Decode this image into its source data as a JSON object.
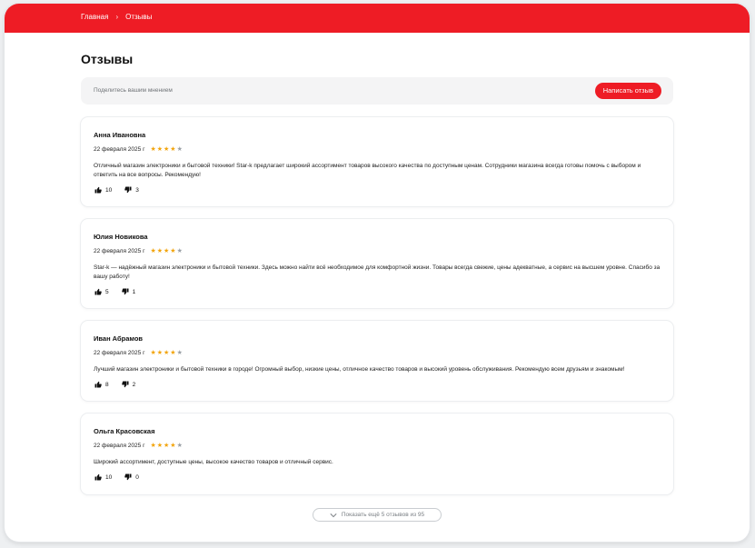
{
  "breadcrumb": {
    "home": "Главная",
    "separator": "›",
    "current": "Отзывы"
  },
  "page": {
    "title": "Отзывы"
  },
  "share": {
    "prompt": "Поделитесь вашим мнением",
    "button_label": "Написать отзыв"
  },
  "reviews": [
    {
      "author": "Анна Ивановна",
      "date": "22 февраля 2025 г",
      "rating": 4,
      "text": "Отличный магазин электроники и бытовой техники! Star-k предлагает широкий ассортимент товаров высокого качества по доступным ценам. Сотрудники магазина всегда готовы помочь с выбором и ответить на все вопросы. Рекомендую!",
      "likes": "10",
      "dislikes": "3"
    },
    {
      "author": "Юлия Новикова",
      "date": "22 февраля 2025 г",
      "rating": 4,
      "text": "Star-k — надёжный магазин электроники и бытовой техники. Здесь можно найти всё необходимое для комфортной жизни. Товары всегда свежие, цены адекватные, а сервис на высшем уровне. Спасибо за вашу работу!",
      "likes": "5",
      "dislikes": "1"
    },
    {
      "author": "Иван Абрамов",
      "date": "22 февраля 2025 г",
      "rating": 4,
      "text": "Лучший магазин электроники и бытовой техники в городе! Огромный выбор, низкие цены, отличное качество товаров и высокий уровень обслуживания. Рекомендую всем друзьям и знакомым!",
      "likes": "8",
      "dislikes": "2"
    },
    {
      "author": "Ольга Красовская",
      "date": "22 февраля 2025 г",
      "rating": 4,
      "text": "Широкий ассортимент, доступные цены, высокое качество товаров и отличный сервис.",
      "likes": "10",
      "dislikes": "0"
    }
  ],
  "show_more": {
    "label": "Показать ещё 5 отзывов из 95",
    "icon": "chevron-down-icon"
  },
  "colors": {
    "brand": "#ee1c25",
    "star": "#f2a40b",
    "star_empty": "#9aa0a6"
  }
}
